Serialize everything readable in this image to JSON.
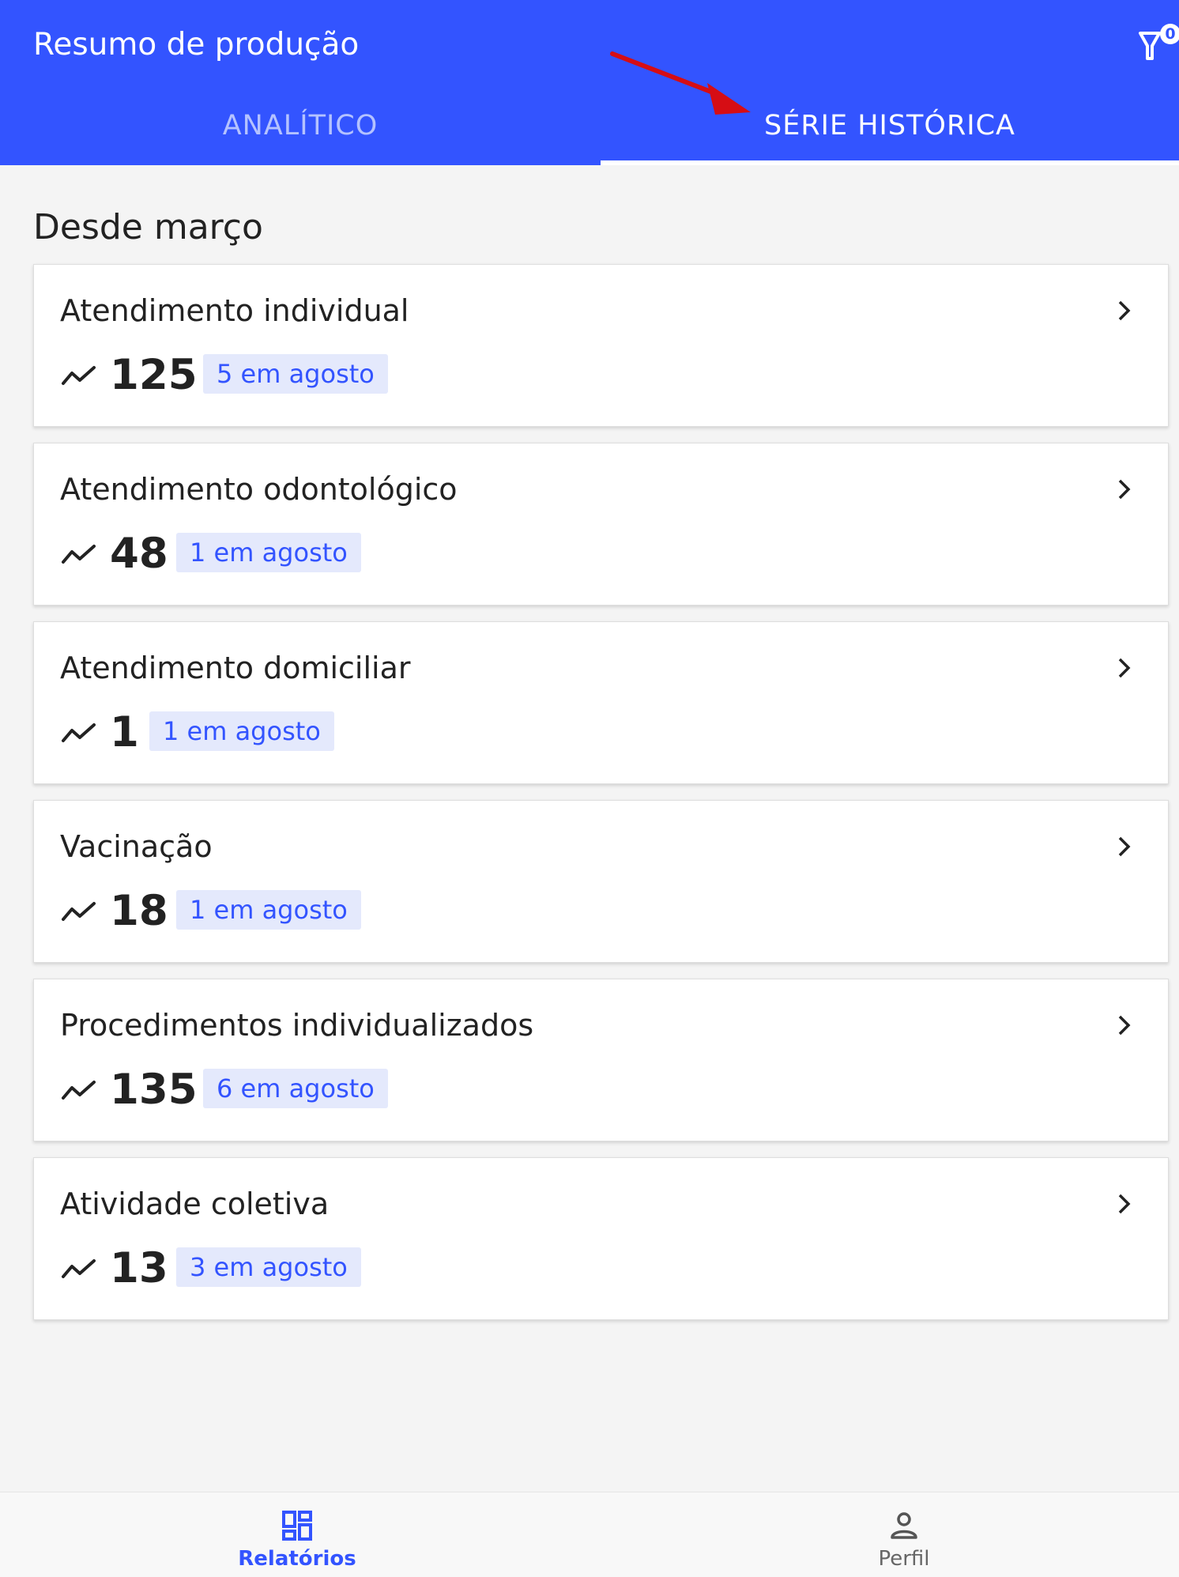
{
  "header": {
    "title": "Resumo de produção",
    "filter_count": "0",
    "tabs": [
      {
        "label": "ANALÍTICO",
        "active": false
      },
      {
        "label": "SÉRIE HISTÓRICA",
        "active": true
      }
    ]
  },
  "main": {
    "section_title": "Desde março",
    "cards": [
      {
        "title": "Atendimento individual",
        "value": "125",
        "badge": "5 em agosto"
      },
      {
        "title": "Atendimento odontológico",
        "value": "48",
        "badge": "1 em agosto"
      },
      {
        "title": "Atendimento domiciliar",
        "value": "1",
        "badge": "1 em agosto"
      },
      {
        "title": "Vacinação",
        "value": "18",
        "badge": "1 em agosto"
      },
      {
        "title": "Procedimentos individualizados",
        "value": "135",
        "badge": "6 em agosto"
      },
      {
        "title": "Atividade coletiva",
        "value": "13",
        "badge": "3 em agosto"
      }
    ]
  },
  "bottom_nav": {
    "items": [
      {
        "label": "Relatórios",
        "icon": "dashboard-icon",
        "active": true
      },
      {
        "label": "Perfil",
        "icon": "person-icon",
        "active": false
      }
    ]
  },
  "colors": {
    "primary": "#3354ff",
    "badge_bg": "#e4e9fc",
    "annotation_arrow": "#d60d14"
  }
}
